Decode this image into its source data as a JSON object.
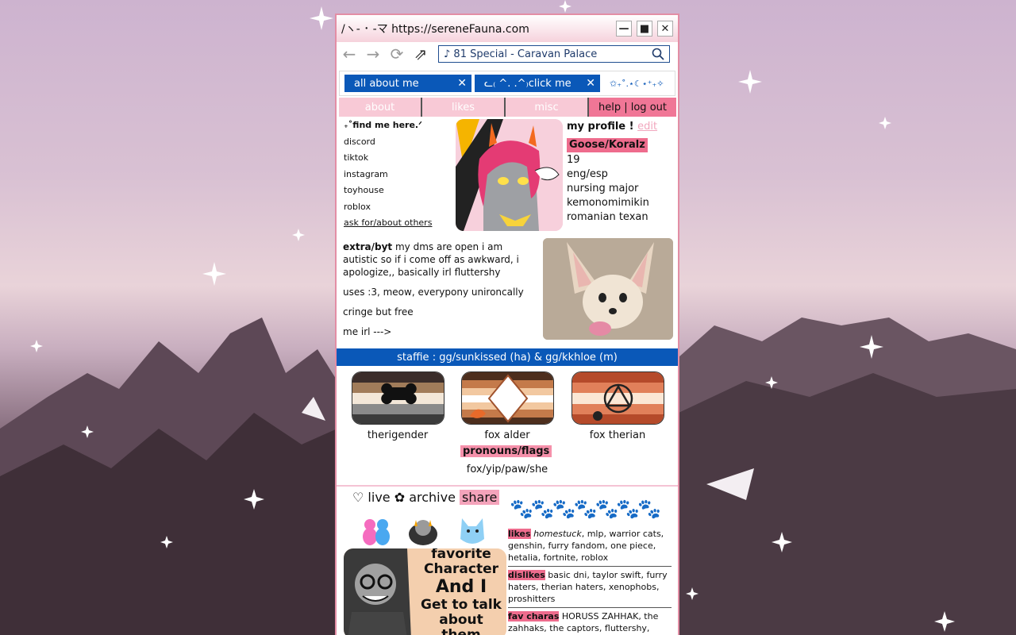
{
  "browser": {
    "title": "/ヽ- ･ -マ https://sereneFauna.com",
    "address": "♪ 81 Special - Caravan Palace",
    "tabs": [
      {
        "label": "all about me"
      },
      {
        "label": "ᓚ₍ ^. .^₎click me"
      }
    ],
    "tab_extra": "✩₊˚.⋆☾⋆⁺₊✧"
  },
  "menu": [
    "about",
    "likes",
    "misc",
    "help | log out"
  ],
  "links": {
    "heading": "₊˚find me here.ᐟ",
    "items": [
      "discord",
      "tiktok",
      "instagram",
      "toyhouse",
      "roblox"
    ],
    "more": "ask for/about others"
  },
  "profile": {
    "heading": "my profile !",
    "edit": "edit",
    "name": "Goose/Koralz",
    "lines": [
      "19",
      "eng/esp",
      "nursing major",
      "kemonomimikin",
      "romanian texan"
    ]
  },
  "bio": {
    "lead": "extra/byt",
    "text": " my dms are open i am autistic so if i come off as awkward, i apologize,, basically irl fluttershy",
    "p2": "uses :3, meow, everypony unironcally",
    "p3": "cringe but free",
    "p4": "me irl --->"
  },
  "staffie": "staffie : gg/sunkissed (ha) & gg/kkhloe (m)",
  "flags": [
    "therigender",
    "fox alder",
    "fox therian"
  ],
  "pronouns": {
    "label": "pronouns/flags",
    "value": "fox/yip/paw/she"
  },
  "bottom": {
    "live": "♡ live ✿ archive",
    "share": "share",
    "paws": "🐾🐾🐾🐾🐾🐾🐾",
    "card_text": [
      "favorite",
      "Character",
      "And I",
      "Get to talk",
      "about",
      "them"
    ],
    "likes_label": "likes",
    "likes_lead": "homestuck",
    "likes_text": ", mlp, warrior cats, genshin, furry fandom, one piece, hetalia, fortnite, roblox",
    "dislikes_label": "dislikes",
    "dislikes_text": " basic dni, taylor swift, furry haters, therian haters, xenophobs, proshitters",
    "fav_label": "fav charas",
    "fav_text": " HORUSS ZAHHAK, the zahhaks, the captors, fluttershy, sanji, orataki itto, aph russia"
  }
}
